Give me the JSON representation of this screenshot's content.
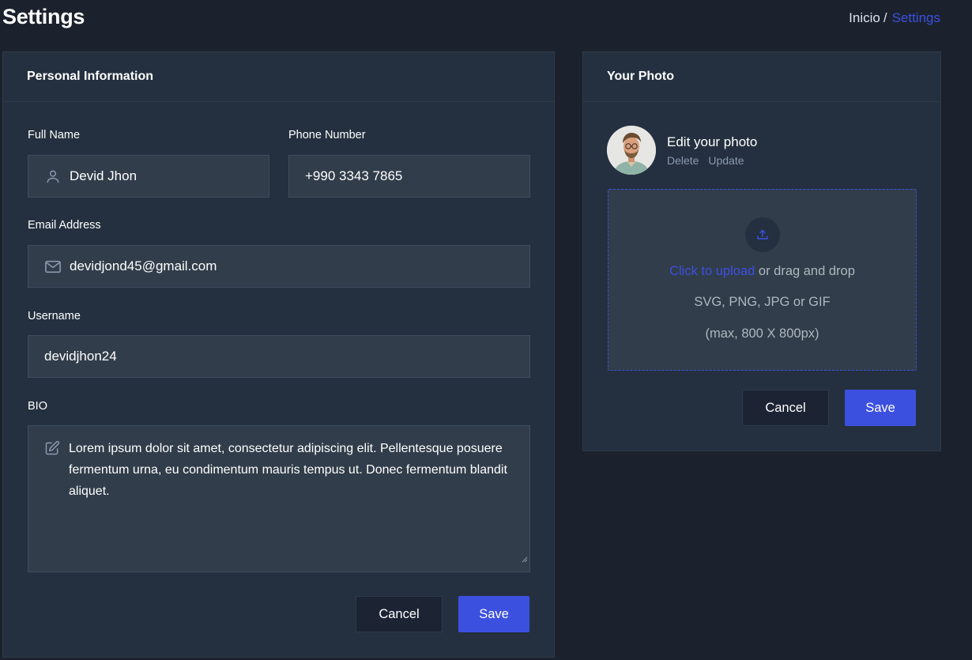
{
  "header": {
    "title": "Settings",
    "breadcrumb": {
      "home": "Inicio",
      "separator": "/",
      "current": "Settings"
    }
  },
  "personal": {
    "title": "Personal Information",
    "full_name": {
      "label": "Full Name",
      "value": "Devid Jhon",
      "icon": "user-icon"
    },
    "phone": {
      "label": "Phone Number",
      "value": "+990 3343 7865"
    },
    "email": {
      "label": "Email Address",
      "value": "devidjond45@gmail.com",
      "icon": "mail-icon"
    },
    "username": {
      "label": "Username",
      "value": "devidjhon24"
    },
    "bio": {
      "label": "BIO",
      "value": "Lorem ipsum dolor sit amet, consectetur adipiscing elit. Pellentesque posuere fermentum urna, eu condimentum mauris tempus ut. Donec fermentum blandit aliquet.",
      "icon": "edit-icon"
    },
    "cancel_label": "Cancel",
    "save_label": "Save"
  },
  "photo": {
    "title": "Your Photo",
    "edit_title": "Edit your photo",
    "delete_label": "Delete",
    "update_label": "Update",
    "upload": {
      "link": "Click to upload",
      "rest": " or drag and drop",
      "formats": "SVG, PNG, JPG or GIF",
      "max": "(max, 800 X 800px)",
      "icon": "upload-icon"
    },
    "cancel_label": "Cancel",
    "save_label": "Save"
  },
  "colors": {
    "background": "#1b222d",
    "card": "#24303f",
    "input": "#313d4a",
    "accent": "#3c50e0"
  }
}
